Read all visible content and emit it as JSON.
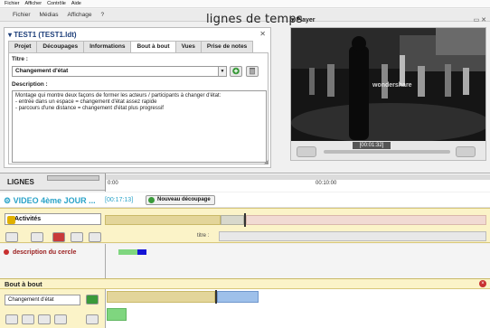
{
  "os_menu": [
    "Fichier",
    "Afficher",
    "Contrôle",
    "Aide"
  ],
  "app_menu": [
    "Fichier",
    "Médias",
    "Affichage",
    "?"
  ],
  "annotation_label": "lignes de temps",
  "player_header": "Player",
  "project": {
    "title": "TEST1 (TEST1.ldt)",
    "tabs": [
      "Projet",
      "Découpages",
      "Informations",
      "Bout à bout",
      "Vues",
      "Prise de notes"
    ],
    "active_tab": "Bout à bout",
    "titre_label": "Titre :",
    "titre_value": "Changement d'état",
    "description_label": "Description :",
    "description_lines": [
      "Montage qui montre deux façons de former les acteurs / participants à changer d'état:",
      "- entrée dans un espace = changement d'état assez rapide",
      "- parcours d'une distance = changement d'état plus progressif"
    ]
  },
  "player": {
    "watermark": "wondershare",
    "time": "[00:01:32]"
  },
  "timeline": {
    "lignes_label": "LIGNES",
    "ruler": [
      "0:00",
      "00:10:00"
    ],
    "video_title": "VIDEO 4ème JOUR ...",
    "video_time": "[00:17:13]",
    "nouveau_label": "Nouveau découpage",
    "activites_label": "Activités",
    "titre_field_label": "titre :",
    "description_track": "description du cercle",
    "bout_a_bout_label": "Bout à bout",
    "bout_a_bout_value": "Changement d'état"
  },
  "colors": {
    "accent": "#2aa3c8",
    "activity_bg": "#fbf3c8",
    "segment_tan": "#e3d59a",
    "segment_blue": "#9ec0ea",
    "segment_pink": "#f1dad3",
    "marker_green": "#7fd67f",
    "marker_blue": "#1414d6"
  }
}
